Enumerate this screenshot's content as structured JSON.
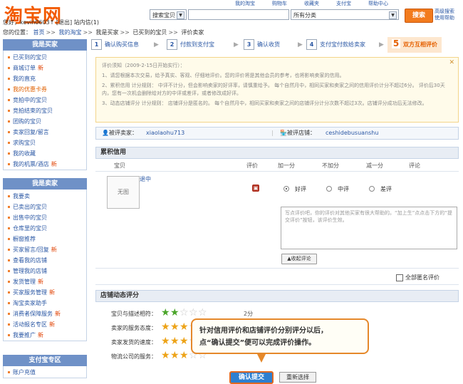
{
  "header": {
    "logo": "淘宝网",
    "top_links": [
      "我的淘宝",
      "购物车",
      "收藏夹",
      "支付宝",
      "帮助中心"
    ],
    "search_scope": "搜索宝贝",
    "search_category": "所有分类",
    "search_button": "搜索",
    "adv_search": "高级搜索",
    "help": "使用帮助"
  },
  "welcome": "您好，kevin0603↑ [退出] 站内信(1)",
  "breadcrumb": [
    "您的位置：",
    "首页",
    "我的淘宝",
    "我是买家",
    "已买到的宝贝",
    "评价卖家"
  ],
  "sidebar": {
    "buyer_title": "我是买家",
    "buyer_items": [
      {
        "label": "已买到的宝贝",
        "new": ""
      },
      {
        "label": "商城订单",
        "new": "新"
      },
      {
        "label": "我的直充",
        "new": ""
      },
      {
        "label": "我的优惠卡券",
        "new": ""
      },
      {
        "label": "竞拍中的宝贝",
        "new": ""
      },
      {
        "label": "竞拍结束的宝贝",
        "new": ""
      },
      {
        "label": "团购的宝贝",
        "new": ""
      },
      {
        "label": "卖家回复/留言",
        "new": ""
      },
      {
        "label": "求购宝贝",
        "new": ""
      },
      {
        "label": "我的收藏",
        "new": ""
      },
      {
        "label": "我的机票/酒店",
        "new": "新"
      }
    ],
    "seller_title": "我是卖家",
    "seller_items": [
      {
        "label": "我要卖",
        "new": ""
      },
      {
        "label": "已卖出的宝贝",
        "new": ""
      },
      {
        "label": "出售中的宝贝",
        "new": ""
      },
      {
        "label": "仓库里的宝贝",
        "new": ""
      },
      {
        "label": "橱窗推荐",
        "new": ""
      },
      {
        "label": "买家留言/回复",
        "new": "新"
      },
      {
        "label": "查看我的店铺",
        "new": ""
      },
      {
        "label": "管理我的店铺",
        "new": ""
      },
      {
        "label": "发货管理",
        "new": "新"
      },
      {
        "label": "买家服务管理",
        "new": "新"
      },
      {
        "label": "淘宝卖家助手",
        "new": ""
      },
      {
        "label": "消费者保障服务",
        "new": "新"
      },
      {
        "label": "活动报名专区",
        "new": "新"
      },
      {
        "label": "我要推广",
        "new": "新"
      }
    ],
    "alipay_title": "支付宝专区",
    "alipay_items": [
      {
        "label": "账户充值",
        "new": ""
      }
    ]
  },
  "steps": [
    {
      "num": "1",
      "label": "确认购买信息"
    },
    {
      "num": "2",
      "label": "付款到支付宝"
    },
    {
      "num": "3",
      "label": "确认收货"
    },
    {
      "num": "4",
      "label": "支付宝付款给卖家"
    },
    {
      "num": "5",
      "label": "双方互相评价"
    }
  ],
  "notice": {
    "title": "评价须知（2009-2-15日开始实行）：",
    "items": [
      "1、请您根据本次交易，给予真实、客观、仔细地评价。您的评价将是其他会员的参考，也将影响卖家的信用。",
      "2、累积信用 计分规则： 中评不计分，但会影响卖家的好评率，请慎重给予。 每个自然月中，相同买家和卖家之间的信用评价计分不超过6分。 评价后30天内，您有一次机会删除给对方的中评或差评，或者修改成好评。",
      "3、动态店铺评分 计分规则： 店铺评分是匿名的。 每个自然月中，相同买家和卖家之间的店铺评分计分次数不超过3次。店铺评分成功后无法修改。"
    ],
    "close": "✕"
  },
  "seller_bar": {
    "seller_label": "被评卖家：",
    "seller": "xiaolaohu713",
    "shop_label": "被评店铺：",
    "shop": "ceshidebusuanshu"
  },
  "credit": {
    "title": "累积信用",
    "cols": [
      "宝贝",
      "评价",
      "加一分",
      "不加分",
      "减一分",
      "评论"
    ],
    "image_label": "无图",
    "item_link": "退中",
    "ratings": [
      "好评",
      "中评",
      "差评"
    ],
    "comment_placeholder": "写点评价吧，你的评价对其他买家有很大帮助的。“加上生”点点击下方的“提交评价”按钮，该评价生效。",
    "collapse": "▲收起评论",
    "anonymous": "全部匿名评价"
  },
  "dsr": {
    "title": "店铺动态评分",
    "rows": [
      {
        "label": "宝贝与描述相符：",
        "stars": 2,
        "score": "2分",
        "color": "green"
      },
      {
        "label": "卖家的服务态度：",
        "stars": 3,
        "score": "",
        "color": "orange"
      },
      {
        "label": "卖家发货的速度：",
        "stars": 3,
        "score": "",
        "color": "orange"
      },
      {
        "label": "物流公司的服务：",
        "stars": 3,
        "score": "",
        "color": "orange"
      }
    ]
  },
  "tooltip": {
    "line1": "针对信用评价和店铺评价分别评分以后，",
    "line2": "点“确认提交”便可以完成评价操作。"
  },
  "buttons": {
    "submit": "确认提交",
    "reset": "重新选择"
  },
  "colors": {
    "brand": "#f25a00",
    "link": "#2a57a4",
    "sidebar_head": "#6f91c7",
    "tooltip_border": "#e5882a"
  }
}
